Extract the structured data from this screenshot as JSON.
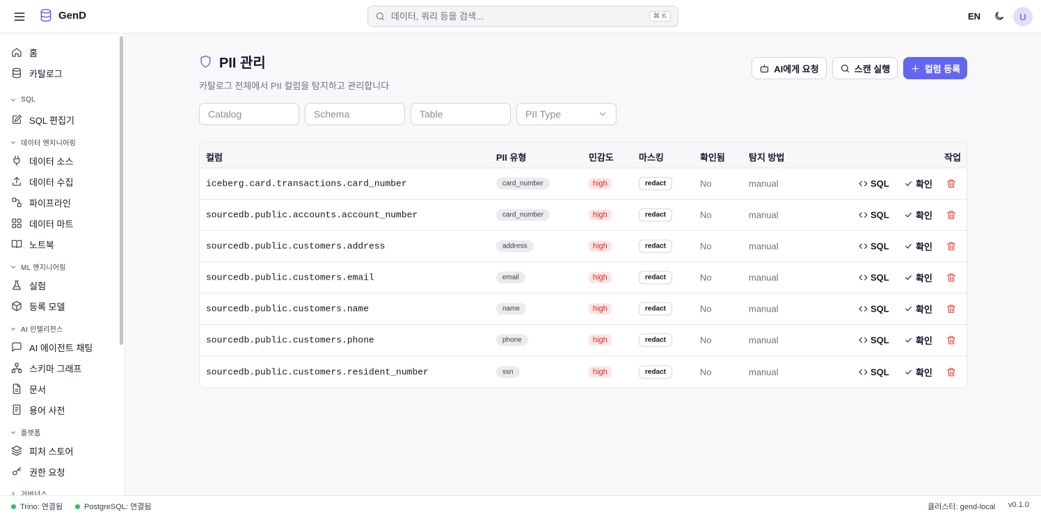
{
  "header": {
    "logo": "GenD",
    "search_placeholder": "데이터, 쿼리 등을 검색...",
    "search_shortcut": "⌘ K",
    "lang": "EN",
    "avatar": "U"
  },
  "sidebar": {
    "items": [
      {
        "label": "홈",
        "icon": "home-icon"
      },
      {
        "label": "카탈로그",
        "icon": "database-icon"
      },
      {
        "label": "SQL 편집기",
        "icon": "edit-icon"
      },
      {
        "label": "데이터 소스",
        "icon": "plug-icon"
      },
      {
        "label": "데이터 수집",
        "icon": "upload-icon"
      },
      {
        "label": "파이프라인",
        "icon": "workflow-icon"
      },
      {
        "label": "데이터 마트",
        "icon": "grid-icon"
      },
      {
        "label": "노트북",
        "icon": "book-icon"
      },
      {
        "label": "실험",
        "icon": "flask-icon"
      },
      {
        "label": "등록 모델",
        "icon": "box-icon"
      },
      {
        "label": "AI 에이전트 채팅",
        "icon": "chat-icon"
      },
      {
        "label": "스키마 그래프",
        "icon": "network-icon"
      },
      {
        "label": "문서",
        "icon": "file-icon"
      },
      {
        "label": "용어 사전",
        "icon": "dictionary-icon"
      },
      {
        "label": "피처 스토어",
        "icon": "layers-icon"
      },
      {
        "label": "권한 요청",
        "icon": "key-icon"
      }
    ],
    "sections": [
      "SQL",
      "데이터 엔지니어링",
      "ML 엔지니어링",
      "AI 인텔리전스",
      "플랫폼",
      "거버넌스"
    ]
  },
  "page": {
    "title": "PII 관리",
    "subtitle": "카탈로그 전체에서 PII 컬럼을 탐지하고 관리합니다",
    "btn_ai": "AI에게 요청",
    "btn_scan": "스캔 실행",
    "btn_register": "컬럼 등록"
  },
  "filters": {
    "catalog": "Catalog",
    "schema": "Schema",
    "table": "Table",
    "pii_type": "PII Type"
  },
  "table": {
    "headers": [
      "컬럼",
      "PII 유형",
      "민감도",
      "마스킹",
      "확인됨",
      "탐지 방법",
      "작업"
    ],
    "action_sql": "SQL",
    "action_confirm": "확인",
    "rows": [
      {
        "column": "iceberg.card.transactions.card_number",
        "pii_type": "card_number",
        "sensitivity": "high",
        "masking": "redact",
        "confirmed": "No",
        "method": "manual"
      },
      {
        "column": "sourcedb.public.accounts.account_number",
        "pii_type": "card_number",
        "sensitivity": "high",
        "masking": "redact",
        "confirmed": "No",
        "method": "manual"
      },
      {
        "column": "sourcedb.public.customers.address",
        "pii_type": "address",
        "sensitivity": "high",
        "masking": "redact",
        "confirmed": "No",
        "method": "manual"
      },
      {
        "column": "sourcedb.public.customers.email",
        "pii_type": "email",
        "sensitivity": "high",
        "masking": "redact",
        "confirmed": "No",
        "method": "manual"
      },
      {
        "column": "sourcedb.public.customers.name",
        "pii_type": "name",
        "sensitivity": "high",
        "masking": "redact",
        "confirmed": "No",
        "method": "manual"
      },
      {
        "column": "sourcedb.public.customers.phone",
        "pii_type": "phone",
        "sensitivity": "high",
        "masking": "redact",
        "confirmed": "No",
        "method": "manual"
      },
      {
        "column": "sourcedb.public.customers.resident_number",
        "pii_type": "ssn",
        "sensitivity": "high",
        "masking": "redact",
        "confirmed": "No",
        "method": "manual"
      }
    ]
  },
  "status": {
    "trino": "Trino: 연결됨",
    "postgres": "PostgreSQL: 연결됨",
    "cluster": "클러스터: gend-local",
    "version": "v0.1.0"
  },
  "colors": {
    "accent": "#6366f1",
    "danger": "#ef4444",
    "ok": "#22c55e"
  }
}
